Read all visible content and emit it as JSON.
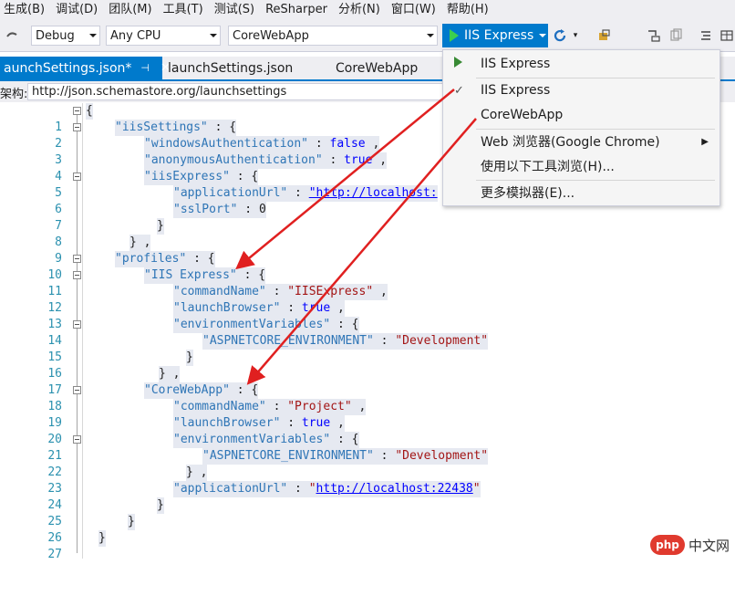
{
  "menubar": {
    "items": [
      "生成(B)",
      "调试(D)",
      "团队(M)",
      "工具(T)",
      "测试(S)",
      "ReSharper",
      "分析(N)",
      "窗口(W)",
      "帮助(H)"
    ]
  },
  "toolbar": {
    "config": "Debug",
    "platform": "Any CPU",
    "project": "CoreWebApp",
    "run_label": "IIS Express"
  },
  "tabs": [
    {
      "label": "aunchSettings.json*",
      "active": true
    },
    {
      "label": "launchSettings.json",
      "active": false
    },
    {
      "label": "CoreWebApp",
      "active": false
    }
  ],
  "schema": {
    "label": "架构:",
    "value": "http://json.schemastore.org/launchsettings"
  },
  "dropdown": {
    "items": [
      {
        "label": "IIS Express",
        "icon": "play-icon"
      },
      {
        "label": "IIS Express",
        "checked": true
      },
      {
        "label": "CoreWebApp"
      },
      {
        "label": "Web 浏览器(Google Chrome)",
        "submenu": true
      },
      {
        "label": "使用以下工具浏览(H)..."
      },
      {
        "label": "更多模拟器(E)..."
      }
    ]
  },
  "code": {
    "line_numbers": [
      "1",
      "2",
      "3",
      "4",
      "5",
      "6",
      "7",
      "8",
      "9",
      "10",
      "11",
      "12",
      "13",
      "14",
      "15",
      "16",
      "17",
      "18",
      "19",
      "20",
      "21",
      "22",
      "23",
      "24",
      "25",
      "26",
      "27"
    ],
    "l1": "{",
    "l2k": "\"iisSettings\"",
    "l2p": " : {",
    "l3k": "\"windowsAuthentication\"",
    "l3p": " : ",
    "l3v": "false",
    "l3e": " ,",
    "l4k": "\"anonymousAuthentication\"",
    "l4p": " : ",
    "l4v": "true",
    "l4e": " ,",
    "l5k": "\"iisExpress\"",
    "l5p": " : {",
    "l6k": "\"applicationUrl\"",
    "l6p": " : ",
    "l6v": "\"http://localhost:",
    "l7k": "\"sslPort\"",
    "l7p": " : ",
    "l7v": "0",
    "l8": "}",
    "l9": "} ,",
    "l10k": "\"profiles\"",
    "l10p": " : {",
    "l11k": "\"IIS Express\"",
    "l11p": " : {",
    "l12k": "\"commandName\"",
    "l12p": " : ",
    "l12v": "\"IISExpress\"",
    "l12e": " ,",
    "l13k": "\"launchBrowser\"",
    "l13p": " : ",
    "l13v": "true",
    "l13e": " ,",
    "l14k": "\"environmentVariables\"",
    "l14p": " : {",
    "l15k": "\"ASPNETCORE_ENVIRONMENT\"",
    "l15p": " : ",
    "l15v": "\"Development\"",
    "l16": "}",
    "l17": "} ,",
    "l18k": "\"CoreWebApp\"",
    "l18p": " : {",
    "l19k": "\"commandName\"",
    "l19p": " : ",
    "l19v": "\"Project\"",
    "l19e": " ,",
    "l20k": "\"launchBrowser\"",
    "l20p": " : ",
    "l20v": "true",
    "l20e": " ,",
    "l21k": "\"environmentVariables\"",
    "l21p": " : {",
    "l22k": "\"ASPNETCORE_ENVIRONMENT\"",
    "l22p": " : ",
    "l22v": "\"Development\"",
    "l23": "} ,",
    "l24k": "\"applicationUrl\"",
    "l24p": " : ",
    "l24q1": "\"",
    "l24v": "http://localhost:22438",
    "l24q2": "\"",
    "l25": "}",
    "l26": "}",
    "l27": "}"
  },
  "watermark": {
    "badge": "php",
    "text": "中文网"
  },
  "colors": {
    "accent": "#007acc",
    "arrow": "#e02020",
    "run_play": "#3ccf4e"
  }
}
